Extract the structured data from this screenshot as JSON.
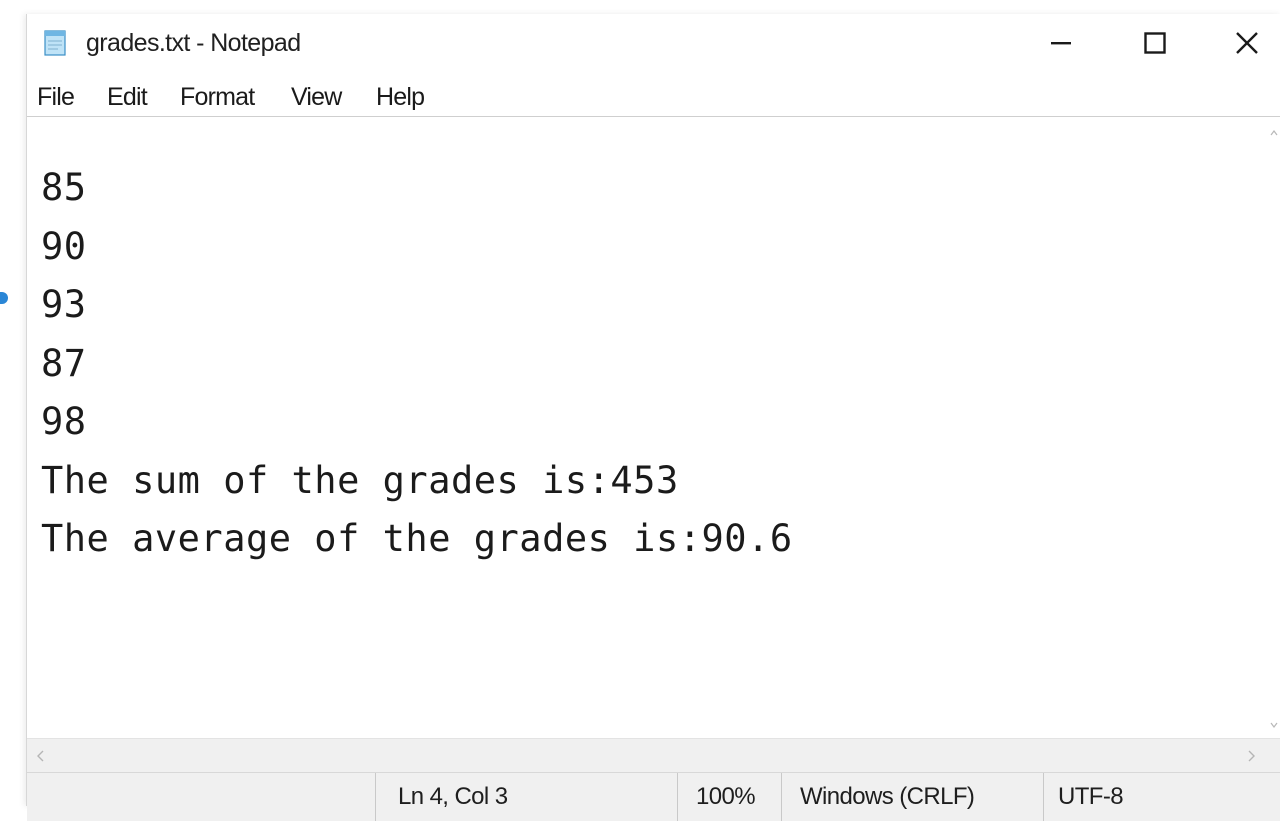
{
  "window": {
    "title": "grades.txt - Notepad",
    "controls": {
      "minimize_icon": "minimize-icon",
      "maximize_icon": "maximize-icon",
      "close_icon": "close-icon"
    }
  },
  "menu": {
    "items": [
      {
        "label": "File"
      },
      {
        "label": "Edit"
      },
      {
        "label": "Format"
      },
      {
        "label": "View"
      },
      {
        "label": "Help"
      }
    ]
  },
  "editor": {
    "lines": [
      "85",
      "90",
      "93",
      "87",
      "98",
      "The sum of the grades is:453",
      "The average of the grades is:90.6"
    ]
  },
  "status": {
    "position": "Ln 4, Col 3",
    "zoom": "100%",
    "line_ending": "Windows (CRLF)",
    "encoding": "UTF-8"
  },
  "colors": {
    "accent": "#2a86d6",
    "statusbar_bg": "#f0f0f0",
    "text": "#1b1b1b"
  }
}
